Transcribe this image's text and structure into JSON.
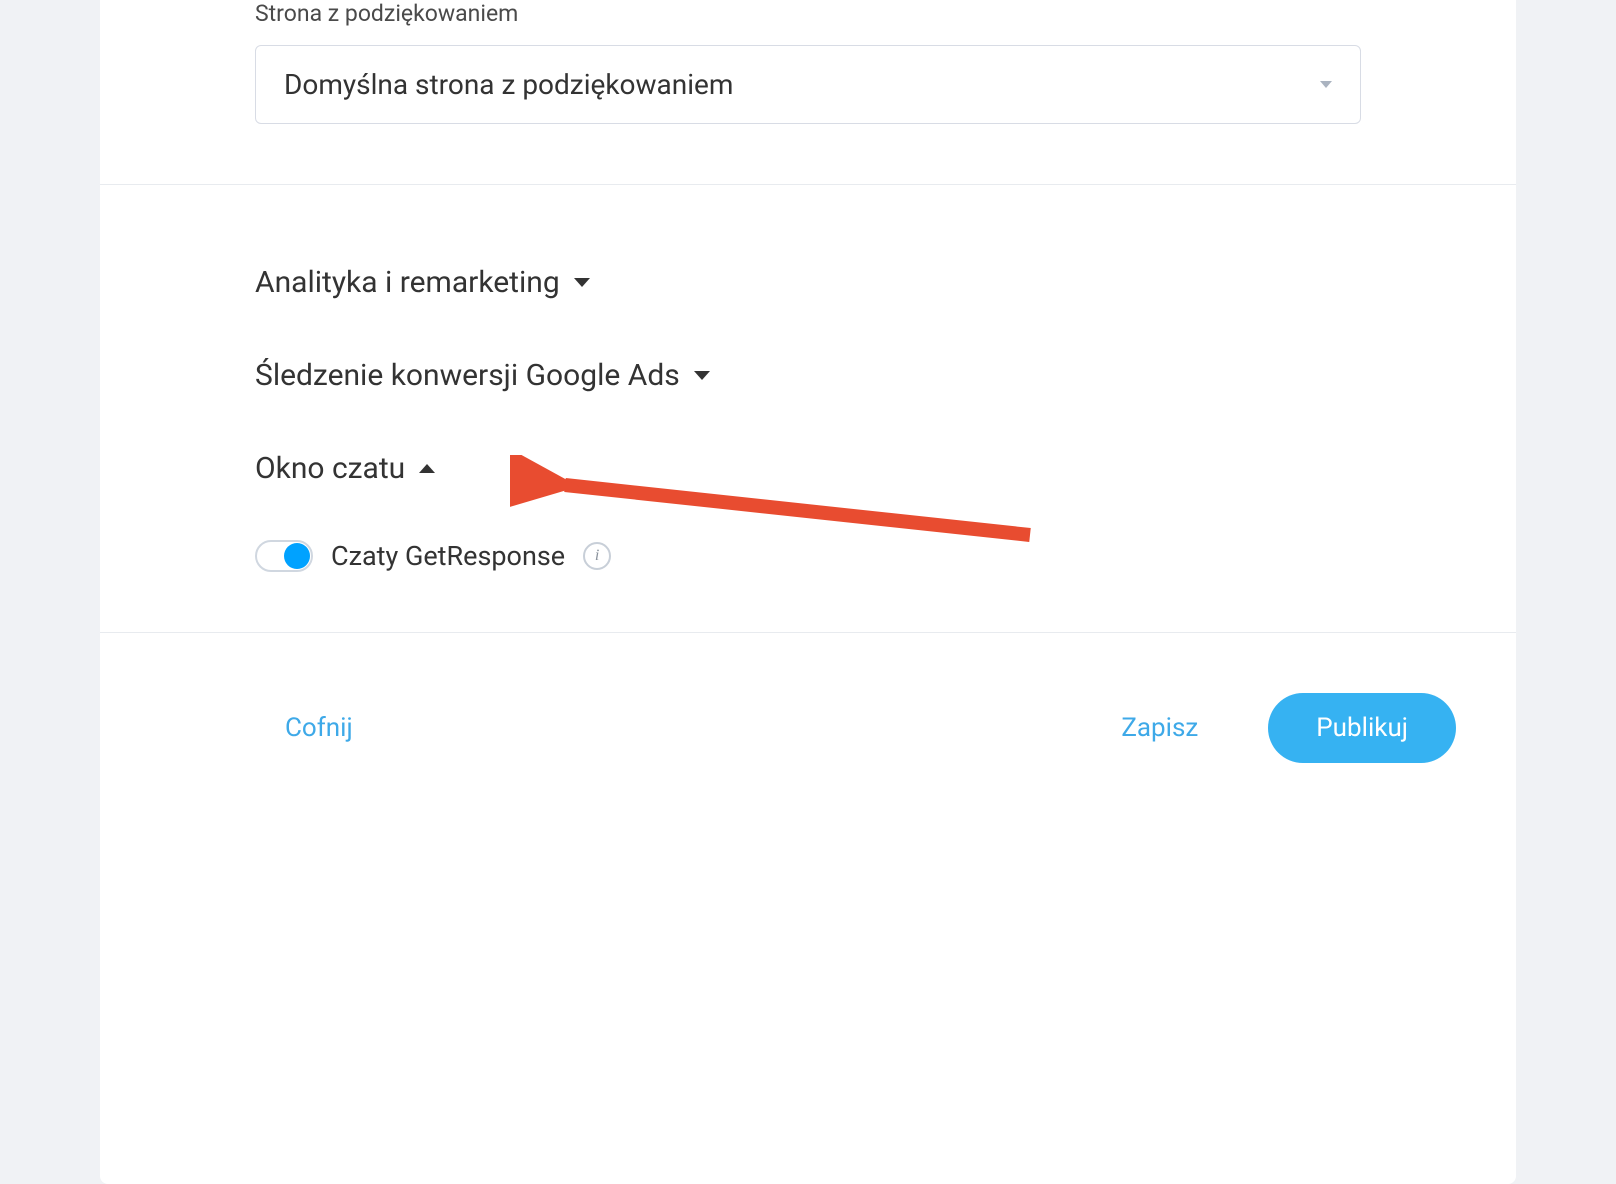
{
  "thankYouPage": {
    "label": "Strona z podziękowaniem",
    "selected": "Domyślna strona z podziękowaniem"
  },
  "sections": {
    "analytics": {
      "title": "Analityka i remarketing"
    },
    "googleAds": {
      "title": "Śledzenie konwersji Google Ads"
    },
    "chatWindow": {
      "title": "Okno czatu"
    }
  },
  "chatToggle": {
    "label": "Czaty GetResponse"
  },
  "footer": {
    "undo": "Cofnij",
    "save": "Zapisz",
    "publish": "Publikuj"
  }
}
